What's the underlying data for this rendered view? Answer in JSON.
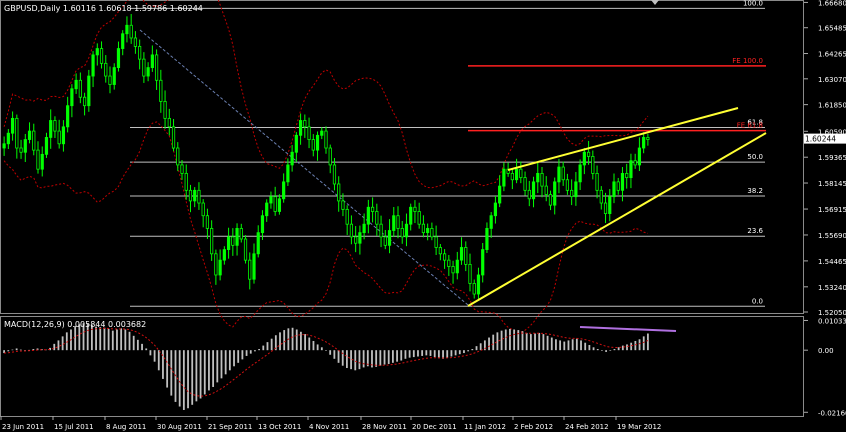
{
  "chart_data": [
    {
      "type": "candlestick",
      "title": "GBPUSD,Daily  1.60116 1.60618 1.59786 1.60244",
      "symbol": "GBPUSD",
      "timeframe": "Daily",
      "ohlc": {
        "open": 1.60116,
        "high": 1.60618,
        "low": 1.59786,
        "close": 1.60244
      },
      "current_price": "1.60244",
      "ylim": [
        1.5205,
        1.667
      ],
      "y_ticks": [
        "1.66680",
        "1.65485",
        "1.64265",
        "1.63070",
        "1.61850",
        "1.60590",
        "1.59365",
        "1.58145",
        "1.56915",
        "1.55690",
        "1.54465",
        "1.53240",
        "1.52050"
      ],
      "x_ticks": [
        "23 Jun 2011",
        "15 Jul 2011",
        "8 Aug 2011",
        "30 Aug 2011",
        "21 Sep 2011",
        "13 Oct 2011",
        "4 Nov 2011",
        "28 Nov 2011",
        "20 Dec 2011",
        "11 Jan 2012",
        "2 Feb 2012",
        "24 Feb 2012",
        "19 Mar 2012"
      ],
      "close_series": [
        1.6,
        1.605,
        1.612,
        1.598,
        1.596,
        1.602,
        1.606,
        1.597,
        1.588,
        1.595,
        1.603,
        1.611,
        1.606,
        1.6,
        1.608,
        1.618,
        1.626,
        1.63,
        1.622,
        1.618,
        1.632,
        1.642,
        1.645,
        1.638,
        1.632,
        1.628,
        1.636,
        1.645,
        1.652,
        1.656,
        1.65,
        1.646,
        1.64,
        1.632,
        1.636,
        1.642,
        1.63,
        1.62,
        1.612,
        1.608,
        1.598,
        1.59,
        1.586,
        1.578,
        1.573,
        1.578,
        1.572,
        1.566,
        1.56,
        1.548,
        1.538,
        1.545,
        1.55,
        1.556,
        1.552,
        1.56,
        1.555,
        1.545,
        1.536,
        1.548,
        1.558,
        1.566,
        1.572,
        1.575,
        1.568,
        1.574,
        1.582,
        1.59,
        1.596,
        1.604,
        1.611,
        1.608,
        1.602,
        1.597,
        1.604,
        1.606,
        1.598,
        1.59,
        1.581,
        1.573,
        1.569,
        1.562,
        1.556,
        1.553,
        1.558,
        1.562,
        1.57,
        1.568,
        1.562,
        1.556,
        1.552,
        1.559,
        1.566,
        1.56,
        1.556,
        1.562,
        1.57,
        1.568,
        1.562,
        1.558,
        1.56,
        1.556,
        1.551,
        1.548,
        1.545,
        1.542,
        1.539,
        1.545,
        1.551,
        1.543,
        1.534,
        1.529,
        1.538,
        1.55,
        1.56,
        1.566,
        1.572,
        1.58,
        1.588,
        1.586,
        1.583,
        1.588,
        1.584,
        1.578,
        1.574,
        1.582,
        1.586,
        1.58,
        1.576,
        1.571,
        1.582,
        1.589,
        1.583,
        1.578,
        1.575,
        1.582,
        1.59,
        1.596,
        1.594,
        1.586,
        1.578,
        1.572,
        1.567,
        1.575,
        1.582,
        1.578,
        1.586,
        1.584,
        1.592,
        1.59,
        1.598,
        1.603,
        1.602
      ],
      "fibonacci": [
        {
          "label": "100.0",
          "value": 1.664
        },
        {
          "label": "61.8",
          "value": 1.6077
        },
        {
          "label": "50.0",
          "value": 1.5913
        },
        {
          "label": "38.2",
          "value": 1.5753
        },
        {
          "label": "23.6",
          "value": 1.5563
        },
        {
          "label": "0.0",
          "value": 1.5232
        }
      ],
      "fib_expansion": [
        {
          "label": "FE 100.0",
          "value": 1.6368
        },
        {
          "label": "FE 61.8",
          "value": 1.6062
        }
      ],
      "colors": {
        "bull": "#00ff00",
        "bear": "#00ff00",
        "envelope": "#c00000",
        "fib": "#c0c0c0",
        "fe": "#ff2020",
        "trend": "#ffff33",
        "diag": "#6a7fb0"
      }
    },
    {
      "type": "bar",
      "title": "MACD(12,26,9) 0.005844 0.003682",
      "indicator": "MACD",
      "params": "(12,26,9)",
      "main": "0.005844",
      "signal": "0.003682",
      "ylim": [
        -0.0222,
        0.0105
      ],
      "y_ticks": [
        "0.010339",
        "0.00",
        "-0.02160"
      ],
      "values": [
        -0.001,
        -0.0004,
        0.0002,
        0.0006,
        0.0002,
        -0.0002,
        0.0001,
        0.0004,
        0.0006,
        0.0004,
        0.0002,
        0.0008,
        0.0022,
        0.0034,
        0.0048,
        0.0062,
        0.0072,
        0.0084,
        0.009,
        0.0094,
        0.0092,
        0.0088,
        0.0082,
        0.008,
        0.0078,
        0.0074,
        0.0068,
        0.0072,
        0.0076,
        0.0072,
        0.0064,
        0.005,
        0.0036,
        0.0022,
        0.0006,
        -0.0018,
        -0.004,
        -0.007,
        -0.01,
        -0.013,
        -0.0158,
        -0.018,
        -0.0196,
        -0.0208,
        -0.0202,
        -0.019,
        -0.0178,
        -0.0168,
        -0.0154,
        -0.014,
        -0.0128,
        -0.0112,
        -0.0098,
        -0.0084,
        -0.007,
        -0.0056,
        -0.0044,
        -0.0032,
        -0.002,
        -0.0012,
        -0.0004,
        0.0004,
        0.0016,
        0.0028,
        0.004,
        0.0052,
        0.0062,
        0.007,
        0.0076,
        0.0078,
        0.0072,
        0.0064,
        0.0056,
        0.0044,
        0.0032,
        0.002,
        0.001,
        0.0,
        -0.0016,
        -0.003,
        -0.0044,
        -0.0054,
        -0.0062,
        -0.0066,
        -0.007,
        -0.0066,
        -0.006,
        -0.0056,
        -0.006,
        -0.0058,
        -0.0054,
        -0.005,
        -0.0048,
        -0.0044,
        -0.004,
        -0.0036,
        -0.003,
        -0.0026,
        -0.0024,
        -0.0022,
        -0.002,
        -0.0018,
        -0.002,
        -0.0024,
        -0.0028,
        -0.003,
        -0.0026,
        -0.0022,
        -0.0018,
        -0.0014,
        -0.001,
        -0.0004,
        0.0004,
        0.0014,
        0.0024,
        0.0034,
        0.0044,
        0.0054,
        0.0062,
        0.0068,
        0.0072,
        0.0074,
        0.0072,
        0.007,
        0.0066,
        0.006,
        0.0056,
        0.0058,
        0.006,
        0.0056,
        0.005,
        0.0044,
        0.0038,
        0.0034,
        0.003,
        0.0034,
        0.0038,
        0.004,
        0.0034,
        0.0026,
        0.0018,
        0.001,
        0.0004,
        -0.0002,
        -0.0006,
        -0.0002,
        0.0004,
        0.001,
        0.0016,
        0.002,
        0.0026,
        0.0032,
        0.0038,
        0.0048,
        0.0058
      ],
      "colors": {
        "bar": "#c0c0c0",
        "signal": "#d01010",
        "divergence": "#b070e0"
      }
    }
  ]
}
